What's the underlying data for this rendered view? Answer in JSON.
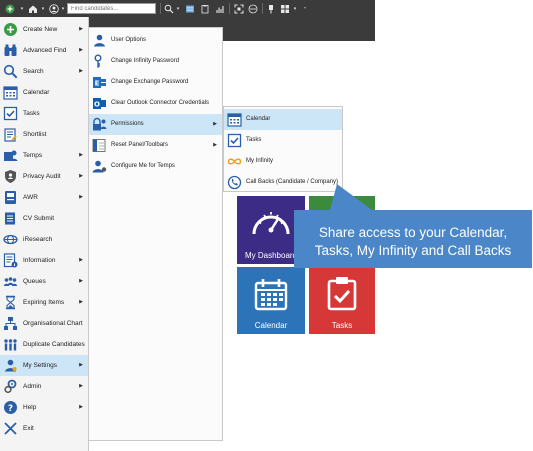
{
  "toolbar": {
    "search_placeholder": "Find candidates...",
    "icons": [
      "create-icon",
      "home-icon",
      "user-icon",
      "search-icon",
      "list-icon",
      "clipboard-icon",
      "chart-icon",
      "expand-icon",
      "share-icon",
      "pin-icon",
      "grid-icon"
    ]
  },
  "main_menu": {
    "items": [
      {
        "label": "Create New",
        "has_submenu": true,
        "icon": "plus-circle-icon"
      },
      {
        "label": "Advanced Find",
        "has_submenu": true,
        "icon": "binoculars-icon"
      },
      {
        "label": "Search",
        "has_submenu": true,
        "icon": "search-icon"
      },
      {
        "label": "Calendar",
        "has_submenu": false,
        "icon": "calendar-icon"
      },
      {
        "label": "Tasks",
        "has_submenu": false,
        "icon": "tasks-icon"
      },
      {
        "label": "Shortlist",
        "has_submenu": false,
        "icon": "shortlist-icon"
      },
      {
        "label": "Temps",
        "has_submenu": true,
        "icon": "temps-icon"
      },
      {
        "label": "Privacy Audit",
        "has_submenu": true,
        "icon": "shield-icon"
      },
      {
        "label": "AWR",
        "has_submenu": true,
        "icon": "awr-icon"
      },
      {
        "label": "CV Submit",
        "has_submenu": false,
        "icon": "cv-submit-icon"
      },
      {
        "label": "iResearch",
        "has_submenu": false,
        "icon": "iresearch-icon"
      },
      {
        "label": "Information",
        "has_submenu": true,
        "icon": "information-icon"
      },
      {
        "label": "Queues",
        "has_submenu": true,
        "icon": "queues-icon"
      },
      {
        "label": "Expiring Items",
        "has_submenu": true,
        "icon": "hourglass-icon"
      },
      {
        "label": "Organisational Chart",
        "has_submenu": false,
        "icon": "org-chart-icon"
      },
      {
        "label": "Duplicate Candidates",
        "has_submenu": false,
        "icon": "duplicate-icon"
      },
      {
        "label": "My Settings",
        "has_submenu": true,
        "icon": "settings-user-icon",
        "highlighted": true
      },
      {
        "label": "Admin",
        "has_submenu": true,
        "icon": "admin-icon"
      },
      {
        "label": "Help",
        "has_submenu": true,
        "icon": "help-icon"
      },
      {
        "label": "Exit",
        "has_submenu": false,
        "icon": "exit-icon"
      }
    ]
  },
  "settings_menu": {
    "items": [
      {
        "label": "User Options",
        "has_submenu": false,
        "icon": "user-options-icon"
      },
      {
        "label": "Change Infinity Password",
        "has_submenu": false,
        "icon": "key-icon"
      },
      {
        "label": "Change Exchange Password",
        "has_submenu": false,
        "icon": "exchange-icon"
      },
      {
        "label": "Clear Outlook Connector Credentials",
        "has_submenu": false,
        "icon": "outlook-icon"
      },
      {
        "label": "Permissions",
        "has_submenu": true,
        "icon": "permissions-icon",
        "highlighted": true
      },
      {
        "label": "Reset Panel/Toolbars",
        "has_submenu": true,
        "icon": "reset-panel-icon"
      },
      {
        "label": "Configure Me for Temps",
        "has_submenu": false,
        "icon": "configure-temps-icon"
      }
    ]
  },
  "permissions_menu": {
    "items": [
      {
        "label": "Calendar",
        "icon": "calendar-icon",
        "highlighted": true
      },
      {
        "label": "Tasks",
        "icon": "tasks-icon"
      },
      {
        "label": "My Infinity",
        "icon": "infinity-icon"
      },
      {
        "label": "Call Backs (Candidate / Company)",
        "icon": "call-back-icon"
      }
    ]
  },
  "dashboard": {
    "tiles": [
      {
        "label": "My Dashboard",
        "color": "#3d2c86",
        "icon": "gauge-icon"
      },
      {
        "label": "",
        "color": "#3b8a3e",
        "icon": ""
      },
      {
        "label": "Calendar",
        "color": "#2c73b8",
        "icon": "calendar-icon"
      },
      {
        "label": "Tasks",
        "color": "#d63838",
        "icon": "tasks-icon"
      }
    ]
  },
  "callout": {
    "line1": "Share access to your Calendar,",
    "line2": "Tasks, My Infinity and Call Backs",
    "color": "#4a86c8"
  }
}
